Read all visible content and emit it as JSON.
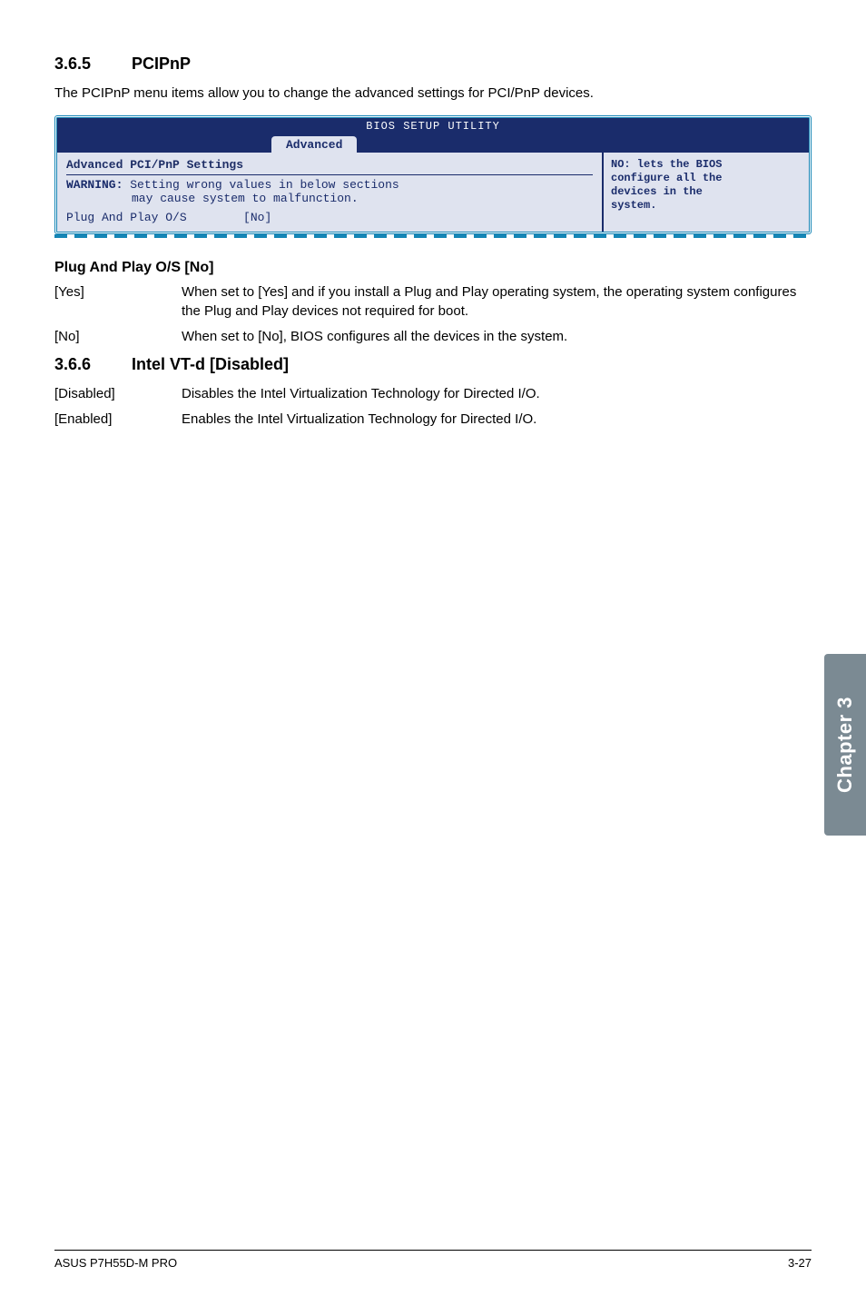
{
  "sections": {
    "pcipnp": {
      "num": "3.6.5",
      "title": "PCIPnP",
      "intro": "The PCIPnP menu items allow you to change the advanced settings for PCI/PnP devices."
    },
    "intelvtd": {
      "num": "3.6.6",
      "title": "Intel VT-d [Disabled]"
    }
  },
  "bios": {
    "title": "BIOS SETUP UTILITY",
    "tab": "Advanced",
    "left": {
      "header": "Advanced PCI/PnP Settings",
      "warn_label": "WARNING:",
      "warn_line1": "Setting wrong values in below sections",
      "warn_line2": "may cause system to malfunction.",
      "row_label": "Plug And Play O/S",
      "row_value": "[No]"
    },
    "right": {
      "line1": "NO: lets the BIOS",
      "line2": "configure all the",
      "line3": "devices in the",
      "line4": "system."
    }
  },
  "pnp_heading": "Plug And Play O/S [No]",
  "defs": {
    "yes_term": "[Yes]",
    "yes_desc": "When set to [Yes] and if you install a Plug and Play operating system, the operating system configures the Plug and Play devices not required for boot.",
    "no_term": "[No]",
    "no_desc": "When set to [No], BIOS configures all the devices in the system.",
    "disabled_term": "[Disabled]",
    "disabled_desc": "Disables the Intel Virtualization Technology for Directed I/O.",
    "enabled_term": "[Enabled]",
    "enabled_desc": "Enables the Intel Virtualization Technology for Directed I/O."
  },
  "side_tab": "Chapter 3",
  "footer": {
    "left": "ASUS P7H55D-M PRO",
    "right": "3-27"
  }
}
